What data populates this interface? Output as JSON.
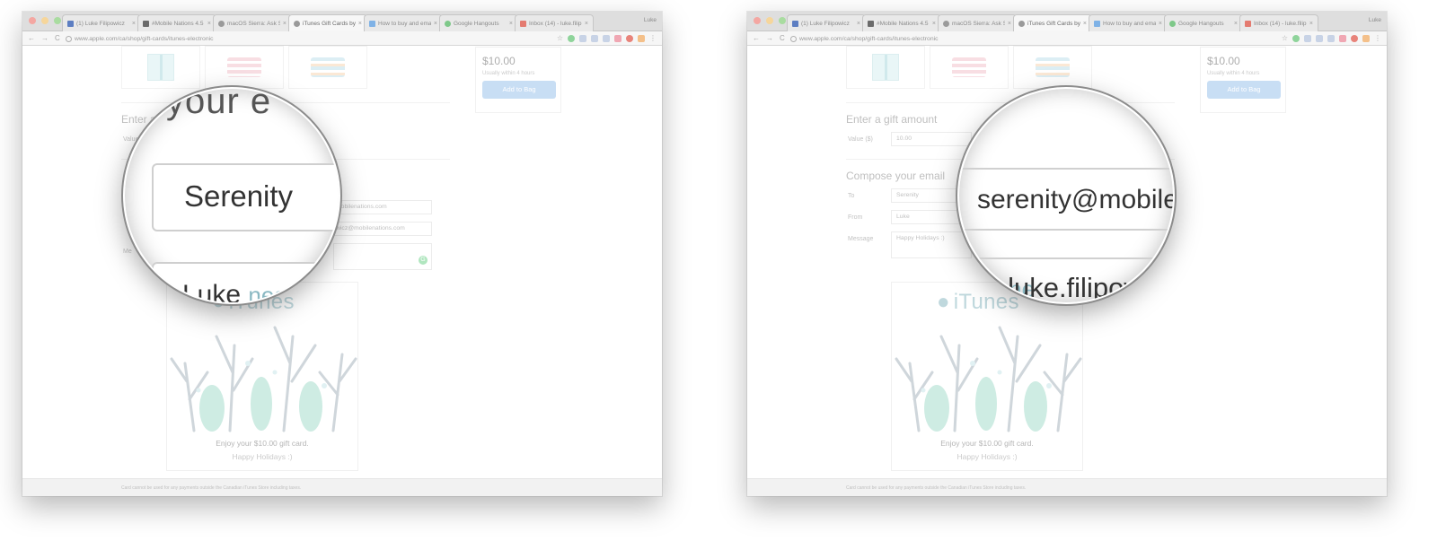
{
  "tabs": [
    {
      "label": "(1) Luke Filipowicz",
      "color": "#5d7ec2"
    },
    {
      "label": "#Mobile Nations 4.5",
      "color": "#6b6b6b"
    },
    {
      "label": "macOS Sierra: Ask Si",
      "color": "#9a9a9a"
    },
    {
      "label": "iTunes Gift Cards by",
      "color": "#9a9a9a"
    },
    {
      "label": "How to buy and emai",
      "color": "#7fb2e6"
    },
    {
      "label": "Google Hangouts",
      "color": "#7ec889"
    },
    {
      "label": "Inbox (14) - luke.filip",
      "color": "#e47b70"
    }
  ],
  "profile_name": "Luke",
  "address": {
    "url": "www.apple.com/ca/shop/gift-cards/itunes-electronic"
  },
  "nav": {
    "back": "←",
    "forward": "→",
    "reload": "C"
  },
  "product": {
    "price": "$10.00",
    "shipping": "Usually within 4 hours",
    "add_button": "Add to Bag"
  },
  "form": {
    "amount_heading": "Enter a gift amount",
    "value_label": "Value ($)",
    "value": "10.00",
    "compose_heading": "Compose your email",
    "to_label": "To",
    "to_name": "Serenity",
    "to_email": "serenity@mobilenations.com",
    "from_label": "From",
    "from_name": "Luke",
    "from_email": "luke.filipowicz@mobilenations.com",
    "message_label": "Message",
    "message": "Happy Holidays :)"
  },
  "left_partial": {
    "amount_heading": "Enter a",
    "value_label": "Value",
    "to_email": "mobilenations.com",
    "from_email": "wicz@mobilenations.com",
    "message_label": "Me"
  },
  "card": {
    "logo_text": "iTunes",
    "enjoy": "Enjoy your $10.00 gift card.",
    "message": "Happy Holidays :)"
  },
  "footer": {
    "text": "Card cannot be used for any payments outside the Canadian iTunes Store including taxes."
  },
  "magnifier_left": {
    "heading_fragment": "your e",
    "field_value": "Serenity",
    "field2_value": "Luke",
    "card_fragment": "nes"
  },
  "magnifier_right": {
    "field_value": "serenity@mobile",
    "field2_value": "luke.filipowic",
    "card_fragment": "iTune"
  }
}
